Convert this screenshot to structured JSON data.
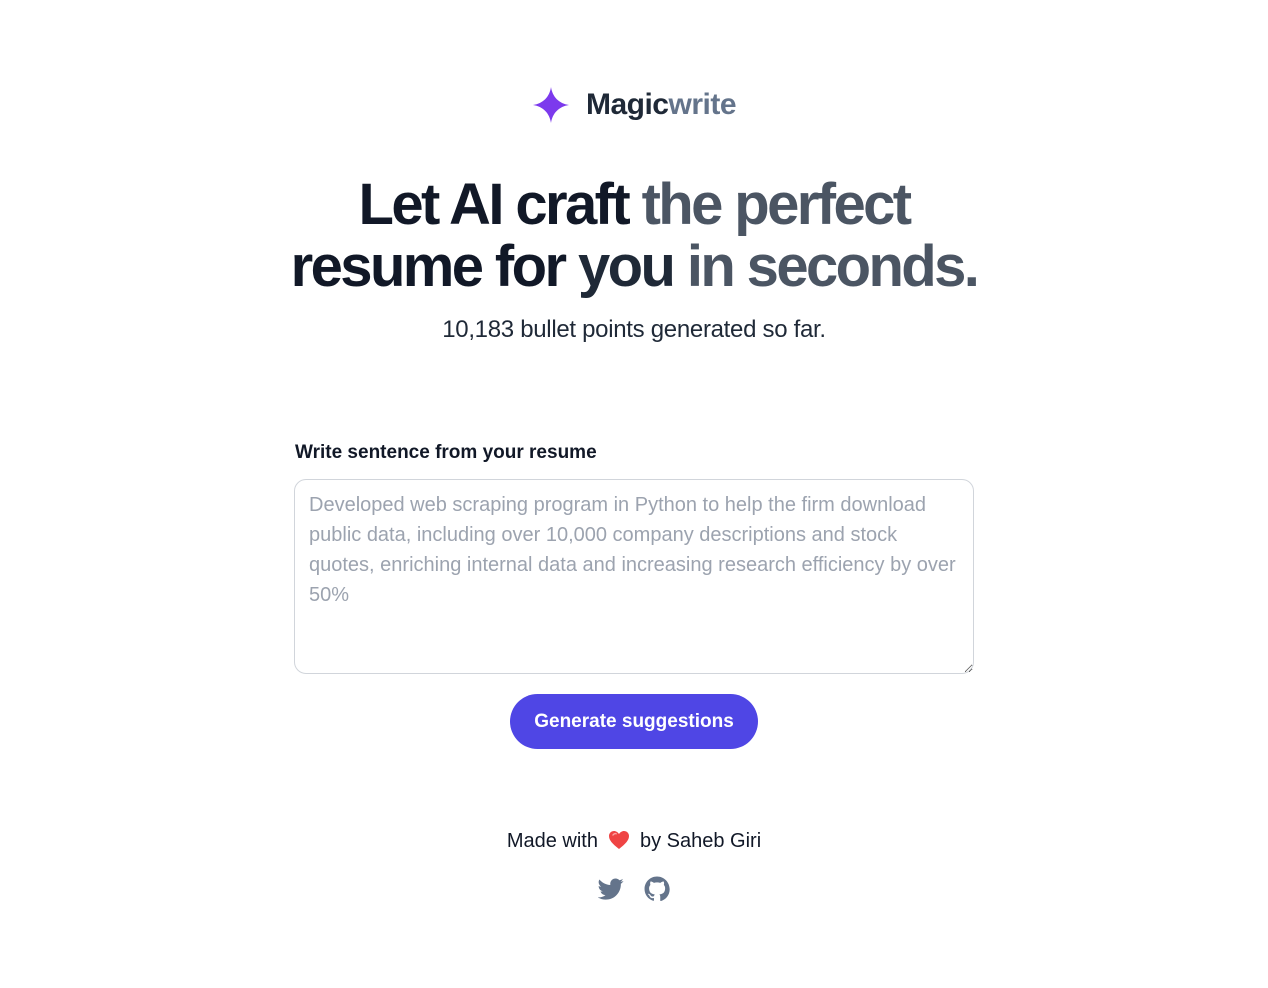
{
  "brand": {
    "name_part1": "Magic",
    "name_part2": "write",
    "star_color": "#7c3aed"
  },
  "hero": {
    "line1_dark": "Let AI craft",
    "line1_grey": "the perfect",
    "line2_dark": "resume for",
    "line2_mid": "you",
    "line2_grey": "in seconds.",
    "stats": "10,183 bullet points generated so far."
  },
  "form": {
    "label": "Write sentence from your resume",
    "placeholder": "Developed web scraping program in Python to help the firm download public data, including over 10,000 company descriptions and stock quotes, enriching internal data and increasing research efficiency by over 50%",
    "value": "",
    "button_label": "Generate suggestions",
    "button_color": "#4f46e5"
  },
  "footer": {
    "made_with": "Made with",
    "by": "by Saheb Giri",
    "heart_icon": "heart-icon",
    "social_icons": [
      "twitter-icon",
      "github-icon"
    ]
  }
}
